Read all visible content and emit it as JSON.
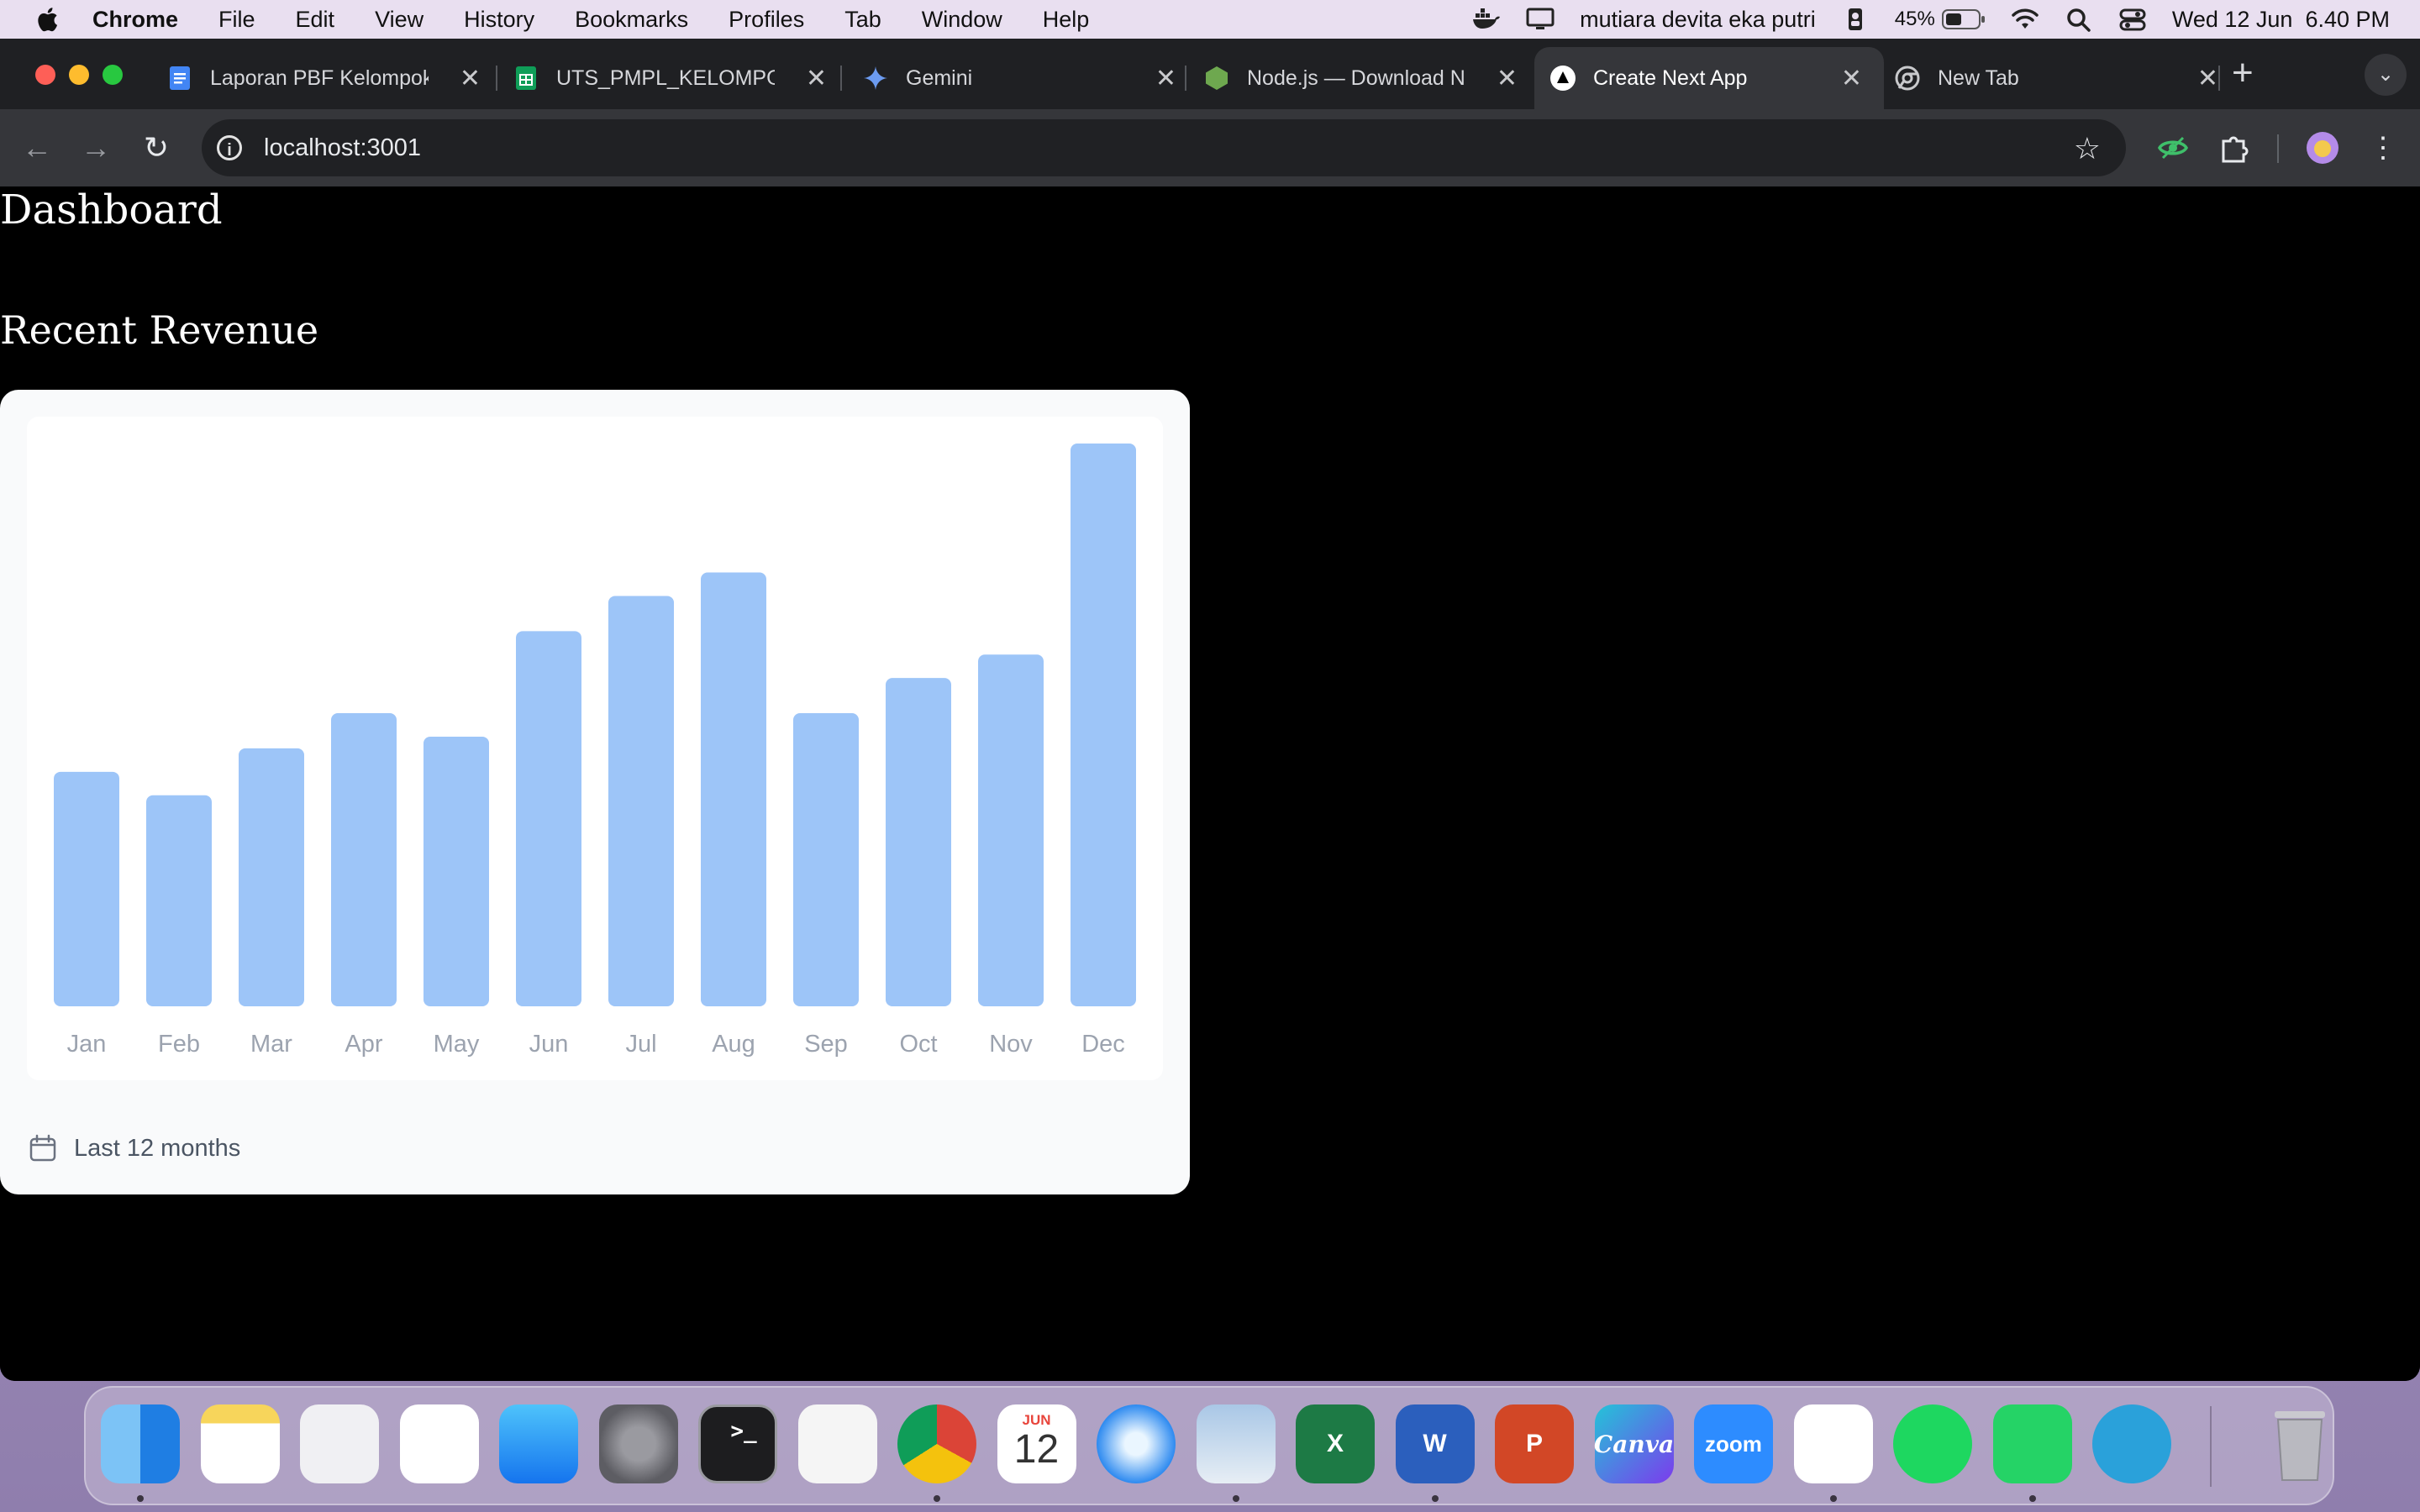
{
  "menubar": {
    "app": "Chrome",
    "items": [
      "File",
      "Edit",
      "View",
      "History",
      "Bookmarks",
      "Profiles",
      "Tab",
      "Window",
      "Help"
    ],
    "user": "mutiara devita eka putri",
    "battery": "45%",
    "datetime": "Wed 12 Jun  6.40 PM"
  },
  "tabs": [
    {
      "title": "Laporan PBF Kelompok",
      "icon": "google-docs-icon",
      "active": false
    },
    {
      "title": "UTS_PMPL_KELOMPOK",
      "icon": "google-sheets-icon",
      "active": false
    },
    {
      "title": "Gemini",
      "icon": "gemini-icon",
      "active": false
    },
    {
      "title": "Node.js — Download Node",
      "icon": "nodejs-icon",
      "active": false
    },
    {
      "title": "Create Next App",
      "icon": "nextjs-icon",
      "active": true
    },
    {
      "title": "New Tab",
      "icon": "chrome-icon",
      "active": false
    }
  ],
  "address_bar": {
    "url": "localhost:3001"
  },
  "page": {
    "title": "Dashboard",
    "section_title": "Recent Revenue",
    "footer_label": "Last 12 months"
  },
  "colors": {
    "bar": "#9dc5f8",
    "axis_label": "#9ca3af",
    "page_bg": "#000000",
    "card_bg": "#f9fafb"
  },
  "chart_data": {
    "type": "bar",
    "categories": [
      "Jan",
      "Feb",
      "Mar",
      "Apr",
      "May",
      "Jun",
      "Jul",
      "Aug",
      "Sep",
      "Oct",
      "Nov",
      "Dec"
    ],
    "values": [
      2000,
      1800,
      2200,
      2500,
      2300,
      3200,
      3500,
      3700,
      2500,
      2800,
      3000,
      4800
    ],
    "title": "",
    "xlabel": "",
    "ylabel": "",
    "ylim": [
      0,
      4800
    ],
    "grid": false,
    "legend": "none"
  },
  "dock": [
    {
      "name": "Finder",
      "icon": "finder-icon",
      "running": true
    },
    {
      "name": "Notes",
      "icon": "notes-icon",
      "running": false
    },
    {
      "name": "Launchpad",
      "icon": "launchpad-icon",
      "running": false
    },
    {
      "name": "Photos",
      "icon": "photos-icon",
      "running": false
    },
    {
      "name": "App Store",
      "icon": "app-store-icon",
      "running": false
    },
    {
      "name": "System Settings",
      "icon": "system-settings-icon",
      "running": false
    },
    {
      "name": "Terminal",
      "icon": "terminal-icon",
      "running": false
    },
    {
      "name": "TextEdit",
      "icon": "textedit-icon",
      "running": false
    },
    {
      "name": "Chrome",
      "icon": "chrome-icon",
      "running": true
    },
    {
      "name": "Calendar",
      "icon": "calendar-icon",
      "running": false,
      "month": "JUN",
      "day": "12"
    },
    {
      "name": "Safari",
      "icon": "safari-icon",
      "running": false
    },
    {
      "name": "Preview",
      "icon": "preview-icon",
      "running": true
    },
    {
      "name": "Excel",
      "icon": "excel-icon",
      "running": false,
      "glyph": "X"
    },
    {
      "name": "Word",
      "icon": "word-icon",
      "running": true,
      "glyph": "W"
    },
    {
      "name": "PowerPoint",
      "icon": "powerpoint-icon",
      "running": false,
      "glyph": "P"
    },
    {
      "name": "Canva",
      "icon": "canva-icon",
      "running": false,
      "glyph": "Canva"
    },
    {
      "name": "Zoom",
      "icon": "zoom-icon",
      "running": false,
      "glyph": "zoom"
    },
    {
      "name": "VS Code",
      "icon": "vscode-icon",
      "running": true
    },
    {
      "name": "Spotify",
      "icon": "spotify-icon",
      "running": false
    },
    {
      "name": "WhatsApp",
      "icon": "whatsapp-icon",
      "running": true
    },
    {
      "name": "Telegram",
      "icon": "telegram-icon",
      "running": false
    },
    {
      "name": "Trash",
      "icon": "trash-icon",
      "running": false
    }
  ]
}
